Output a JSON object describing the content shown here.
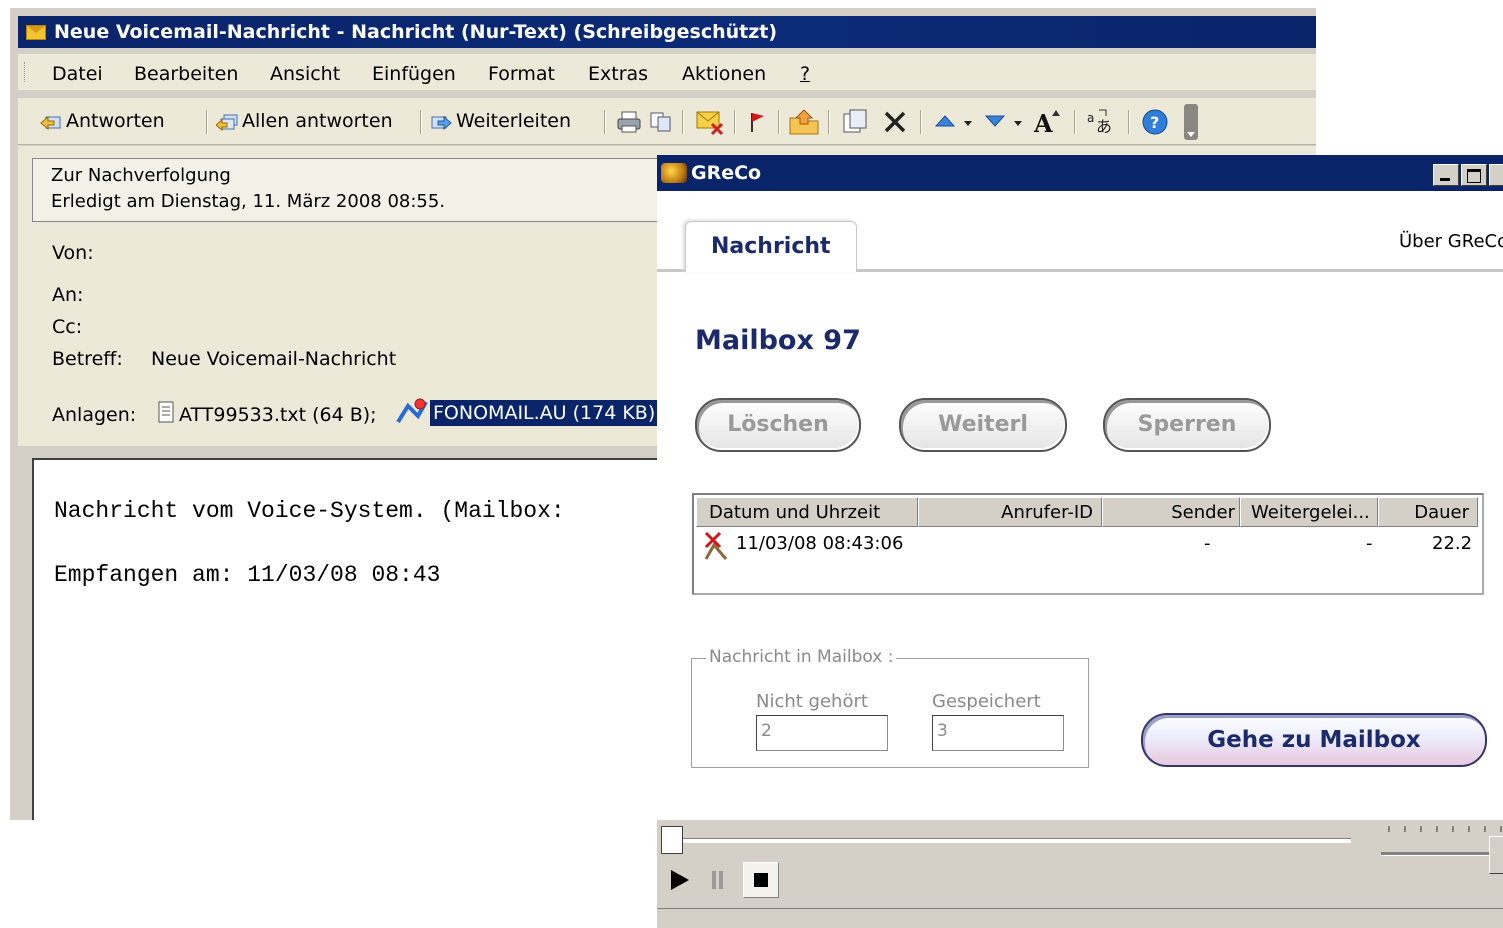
{
  "outlook": {
    "title": "Neue Voicemail-Nachricht - Nachricht (Nur-Text) (Schreibgeschützt)",
    "menu": [
      "Datei",
      "Bearbeiten",
      "Ansicht",
      "Einfügen",
      "Format",
      "Extras",
      "Aktionen",
      "?"
    ],
    "toolbar": {
      "reply": "Antworten",
      "reply_all": "Allen antworten",
      "forward": "Weiterleiten"
    },
    "followup": {
      "line1": "Zur Nachverfolgung",
      "line2": "Erledigt am Dienstag, 11. März 2008 08:55."
    },
    "headers": {
      "from_label": "Von:",
      "to_label": "An:",
      "cc_label": "Cc:",
      "subject_label": "Betreff:",
      "subject_value": "Neue Voicemail-Nachricht",
      "attachments_label": "Anlagen:",
      "attachment1": "ATT99533.txt (64 B);",
      "attachment2": "FONOMAIL.AU (174 KB)"
    },
    "body": {
      "line1": "Nachricht vom Voice-System. (Mailbox:",
      "line2": "Empfangen am: 11/03/08 08:43"
    }
  },
  "greco": {
    "title": "GReCo",
    "tab_label": "Nachricht",
    "about_label": "Über GReCo",
    "mailbox_title": "Mailbox 97",
    "buttons": {
      "delete": "Löschen",
      "forward": "Weiterl",
      "lock": "Sperren"
    },
    "table": {
      "columns": [
        "Datum und Uhrzeit",
        "Anrufer-ID",
        "Sender",
        "Weitergelei...",
        "Dauer"
      ],
      "rows": [
        {
          "datetime": "11/03/08 08:43:06",
          "caller_id": "",
          "sender": "-",
          "forwarded": "-",
          "duration": "22.2"
        }
      ]
    },
    "group": {
      "legend": "Nachricht in Mailbox :",
      "unheard_label": "Nicht gehört",
      "unheard_value": "2",
      "saved_label": "Gespeichert",
      "saved_value": "3"
    },
    "goto_button": "Gehe zu Mailbox",
    "player": {
      "seek_position": 0.0,
      "volume_level": 1.0
    }
  }
}
